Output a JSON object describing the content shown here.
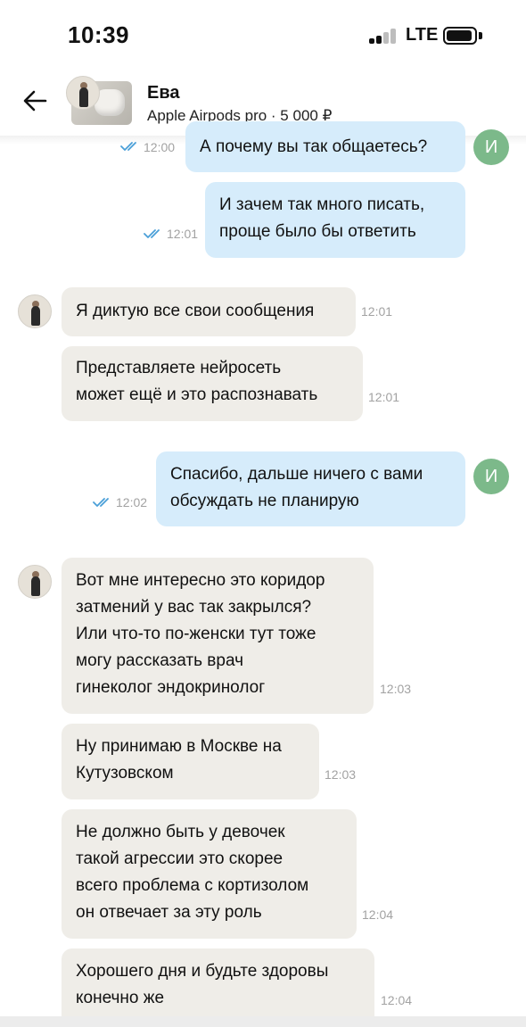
{
  "status_bar": {
    "time": "10:39",
    "network": "LTE"
  },
  "header": {
    "contact_name": "Ева",
    "product": "Apple Airpods pro · 5 000 ₽"
  },
  "my_initial": "И",
  "messages": [
    {
      "dir": "out",
      "text": "А почему вы так общаетесь?",
      "time": "12:00"
    },
    {
      "dir": "out",
      "text": "И зачем так много писать,\nпроще было бы ответить",
      "time": "12:01"
    },
    {
      "dir": "in",
      "text": "Я диктую все свои сообщения",
      "time": "12:01"
    },
    {
      "dir": "in",
      "text": "Представляете нейросеть\nможет ещё и это распознавать",
      "time": "12:01"
    },
    {
      "dir": "out",
      "text": "Спасибо, дальше ничего с вами\nобсуждать не планирую",
      "time": "12:02"
    },
    {
      "dir": "in",
      "text": "Вот мне интересно это коридор\nзатмений у вас так закрылся?\nИли что-то по-женски тут тоже\nмогу рассказать врач\nгинеколог эндокринолог",
      "time": "12:03"
    },
    {
      "dir": "in",
      "text": "Ну принимаю в Москве на\nКутузовском",
      "time": "12:03"
    },
    {
      "dir": "in",
      "text": "Не должно быть у девочек\nтакой агрессии это скорее\nвсего проблема с кортизолом\nон отвечает за эту роль",
      "time": "12:04"
    },
    {
      "dir": "in",
      "text": "Хорошего дня и будьте здоровы\nконечно же",
      "time": "12:04"
    }
  ],
  "colors": {
    "outgoing_bubble": "#d6ecfb",
    "incoming_bubble": "#efede8",
    "avatar_green": "#7cb98a",
    "read_check": "#4a9fd8"
  }
}
